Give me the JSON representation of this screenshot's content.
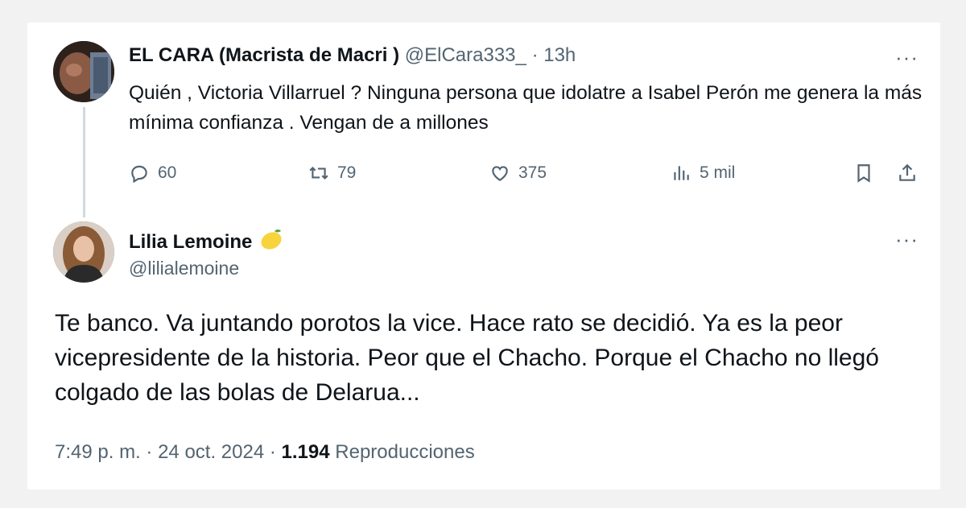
{
  "tweet1": {
    "name": "EL CARA (Macrista de Macri )",
    "handle": "@ElCara333_",
    "separator": "·",
    "time": "13h",
    "text": "Quién , Victoria Villarruel ? Ninguna persona que idolatre a Isabel Perón me genera la más mínima confianza . Vengan de a millones",
    "replies": "60",
    "reposts": "79",
    "likes": "375",
    "views": "5 mil",
    "more": "···"
  },
  "tweet2": {
    "name": "Lilia Lemoine",
    "emoji": "🍋",
    "handle": "@lilialemoine",
    "text": "Te banco. Va juntando porotos la vice. Hace rato se decidió. Ya es la peor vicepresidente de la historia. Peor que el Chacho. Porque el Chacho no llegó colgado de las bolas de Delarua...",
    "more": "···",
    "time": "7:49 p. m.",
    "separator": "·",
    "date": "24 oct. 2024",
    "views_count": "1.194",
    "views_label": "Reproducciones"
  },
  "colors": {
    "text": "#0f1419",
    "muted": "#536471",
    "thread": "#cfd9de"
  },
  "icons": [
    "reply-icon",
    "repost-icon",
    "like-icon",
    "views-icon",
    "bookmark-icon",
    "share-icon",
    "more-icon",
    "lemon-emoji"
  ]
}
